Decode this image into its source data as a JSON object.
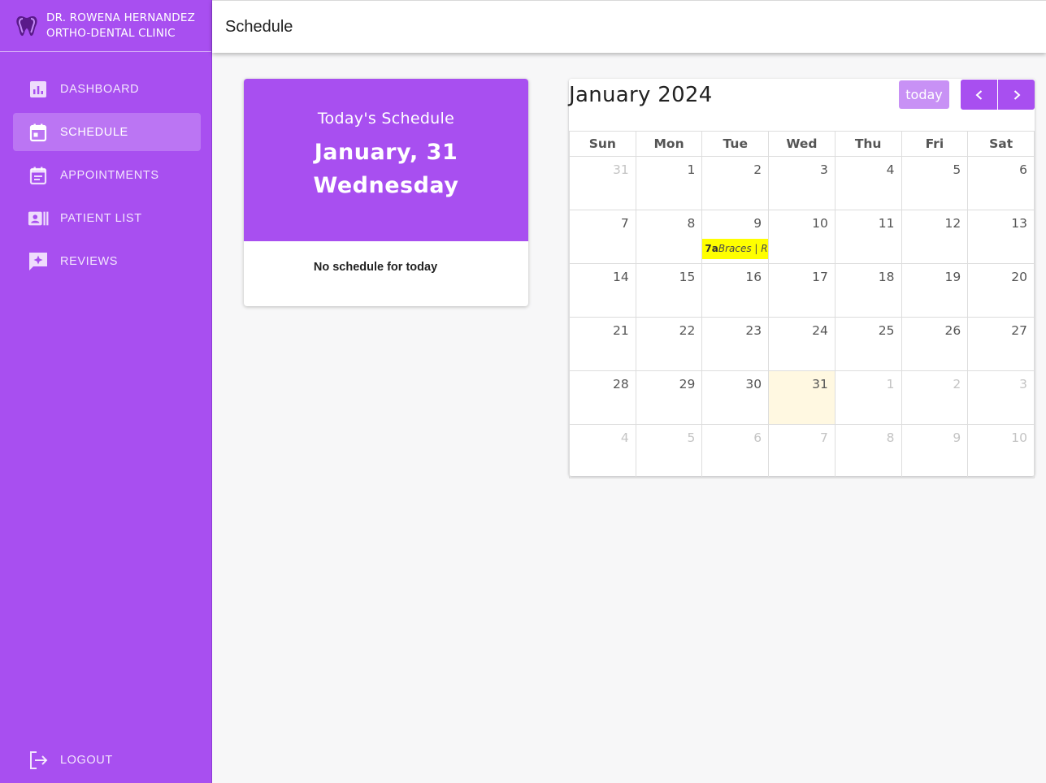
{
  "brand": {
    "line1": "DR. ROWENA HERNANDEZ",
    "line2": "ORTHO-DENTAL CLINIC"
  },
  "colors": {
    "primary": "#a84ff0",
    "event": "#ffff00",
    "today_highlight": "#fff8e1"
  },
  "sidebar": {
    "items": [
      {
        "label": "DASHBOARD",
        "icon": "dashboard-chart-icon",
        "active": false
      },
      {
        "label": "SCHEDULE",
        "icon": "calendar-icon",
        "active": true
      },
      {
        "label": "APPOINTMENTS",
        "icon": "event-note-icon",
        "active": false
      },
      {
        "label": "PATIENT LIST",
        "icon": "contacts-icon",
        "active": false
      },
      {
        "label": "REVIEWS",
        "icon": "review-star-icon",
        "active": false
      }
    ],
    "logout": {
      "label": "LOGOUT",
      "icon": "logout-icon"
    }
  },
  "header": {
    "title": "Schedule"
  },
  "today_card": {
    "title": "Today's Schedule",
    "date_line": "January, 31",
    "weekday": "Wednesday",
    "empty_message": "No schedule for today"
  },
  "calendar": {
    "title": "January 2024",
    "today_button": "today",
    "weekdays": [
      "Sun",
      "Mon",
      "Tue",
      "Wed",
      "Thu",
      "Fri",
      "Sat"
    ],
    "weeks": [
      [
        "31",
        "1",
        "2",
        "3",
        "4",
        "5",
        "6"
      ],
      [
        "7",
        "8",
        "9",
        "10",
        "11",
        "12",
        "13"
      ],
      [
        "14",
        "15",
        "16",
        "17",
        "18",
        "19",
        "20"
      ],
      [
        "21",
        "22",
        "23",
        "24",
        "25",
        "26",
        "27"
      ],
      [
        "28",
        "29",
        "30",
        "31",
        "1",
        "2",
        "3"
      ],
      [
        "4",
        "5",
        "6",
        "7",
        "8",
        "9",
        "10"
      ]
    ],
    "event": {
      "time": "7a",
      "title": "Braces | Re"
    }
  }
}
